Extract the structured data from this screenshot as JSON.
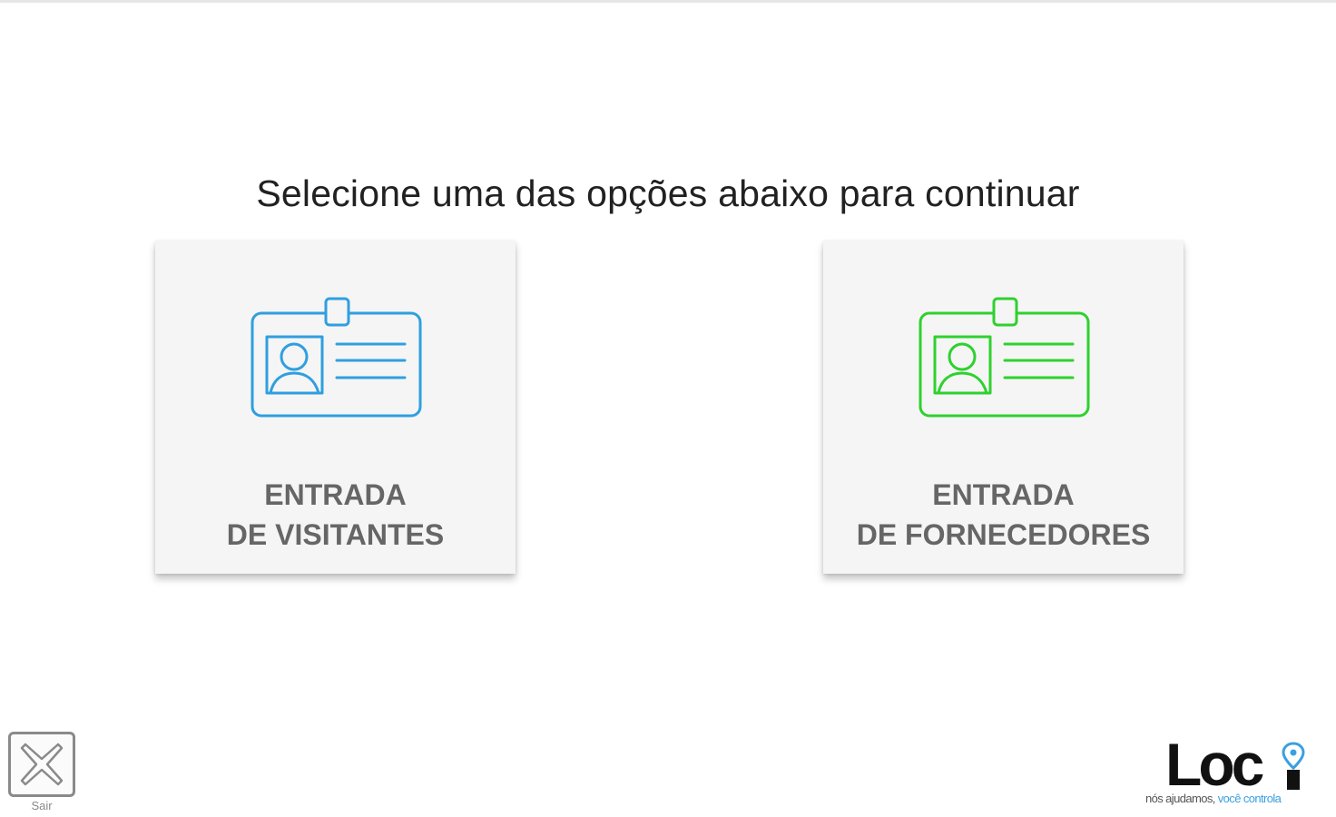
{
  "prompt": "Selecione uma das opções abaixo para continuar",
  "options": [
    {
      "line1": "ENTRADA",
      "line2": "DE VISITANTES",
      "icon": "id-badge-icon",
      "color": "#2f9fe0"
    },
    {
      "line1": "ENTRADA",
      "line2": "DE FORNECEDORES",
      "icon": "id-badge-icon",
      "color": "#2ed12e"
    }
  ],
  "exit": {
    "label": "Sair",
    "icon": "close-icon"
  },
  "logo": {
    "word": "Loc",
    "tagline_part1": "nós ajudamos,",
    "tagline_part2": " você controla",
    "accent_color": "#3aa0e0"
  }
}
